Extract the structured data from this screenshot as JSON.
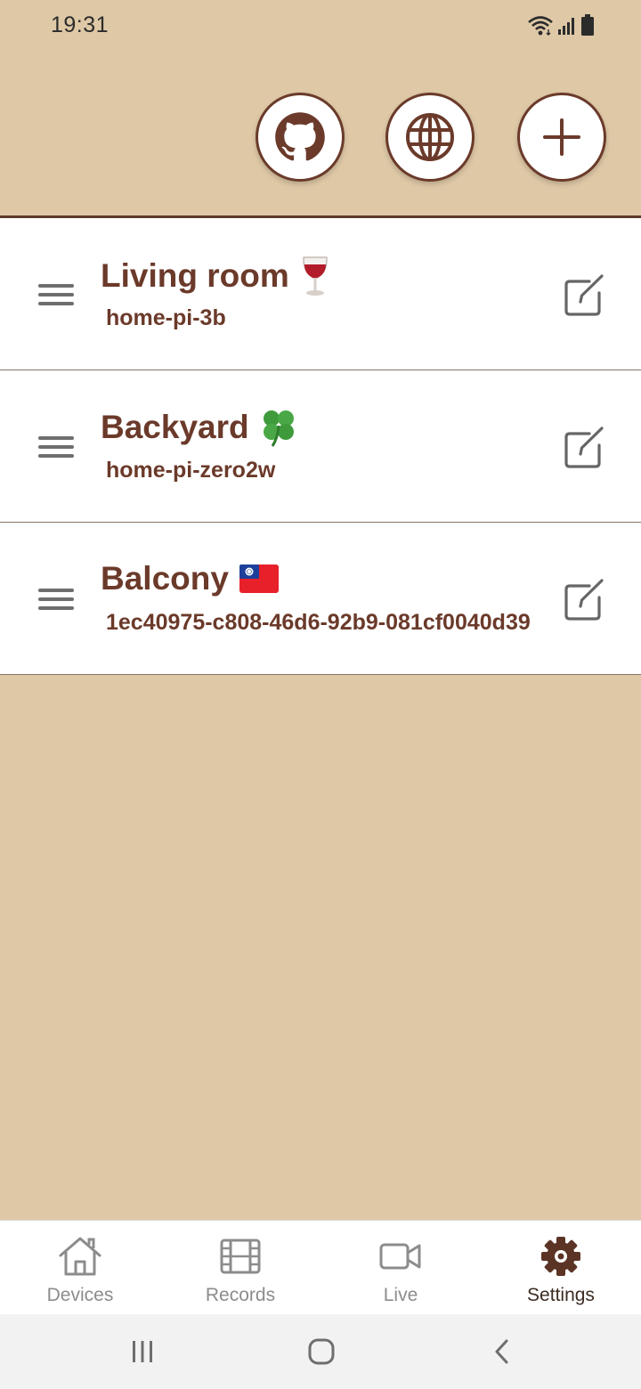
{
  "status_bar": {
    "time": "19:31",
    "icons": [
      "wifi-icon",
      "signal-icon",
      "battery-icon"
    ]
  },
  "header": {
    "actions": [
      {
        "name": "github",
        "icon": "github-icon"
      },
      {
        "name": "website",
        "icon": "globe-icon"
      },
      {
        "name": "add-device",
        "icon": "plus-icon"
      }
    ]
  },
  "devices": [
    {
      "name": "Living room",
      "emoji": "wine-glass-icon",
      "id": "home-pi-3b"
    },
    {
      "name": "Backyard",
      "emoji": "four-leaf-clover-icon",
      "id": "home-pi-zero2w"
    },
    {
      "name": "Balcony",
      "emoji": "taiwan-flag-icon",
      "id": "1ec40975-c808-46d6-92b9-081cf0040d39"
    }
  ],
  "bottom_nav": {
    "items": [
      {
        "label": "Devices",
        "icon": "home-icon"
      },
      {
        "label": "Records",
        "icon": "film-icon"
      },
      {
        "label": "Live",
        "icon": "video-camera-icon"
      },
      {
        "label": "Settings",
        "icon": "gear-icon"
      }
    ],
    "active": "Settings"
  },
  "colors": {
    "background": "#dec8a6",
    "accent": "#6b3a2a",
    "card": "#ffffff",
    "nav_inactive": "#8c8c8c",
    "nav_active": "#5b3425"
  }
}
